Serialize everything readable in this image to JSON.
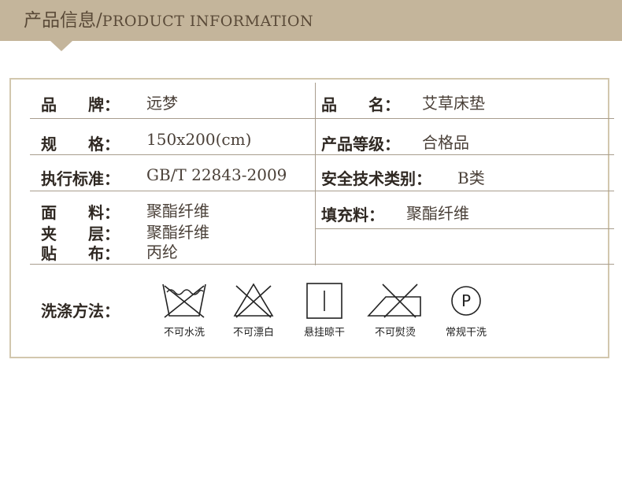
{
  "header": {
    "title_cn": "产品信息/",
    "title_en": "PRODUCT INFORMATION"
  },
  "rows": {
    "brand": {
      "label": "品　　牌：",
      "value": "远梦"
    },
    "name": {
      "label": "品　　名：",
      "value": "艾草床垫"
    },
    "spec": {
      "label": "规　　格：",
      "value": "150x200(cm)"
    },
    "grade": {
      "label": "产品等级：",
      "value": "合格品"
    },
    "standard": {
      "label": "执行标准：",
      "value": "GB/T 22843-2009"
    },
    "safety": {
      "label": "安全技术类别：",
      "value": "B类"
    },
    "fabric": {
      "label": "面　　料：",
      "value": "聚酯纤维"
    },
    "filling": {
      "label": "填充料：",
      "value": "聚酯纤维"
    },
    "layer": {
      "label": "夹　　层：",
      "value": "聚酯纤维"
    },
    "backing": {
      "label": "贴　　布：",
      "value": "丙纶"
    }
  },
  "care": {
    "label": "洗涤方法：",
    "items": [
      {
        "icon": "no-wash-icon",
        "caption": "不可水洗"
      },
      {
        "icon": "no-bleach-icon",
        "caption": "不可漂白"
      },
      {
        "icon": "hang-dry-icon",
        "caption": "悬挂晾干"
      },
      {
        "icon": "no-iron-icon",
        "caption": "不可熨烫"
      },
      {
        "icon": "dry-clean-p-icon",
        "caption": "常规干洗",
        "symbol": "P"
      }
    ]
  }
}
